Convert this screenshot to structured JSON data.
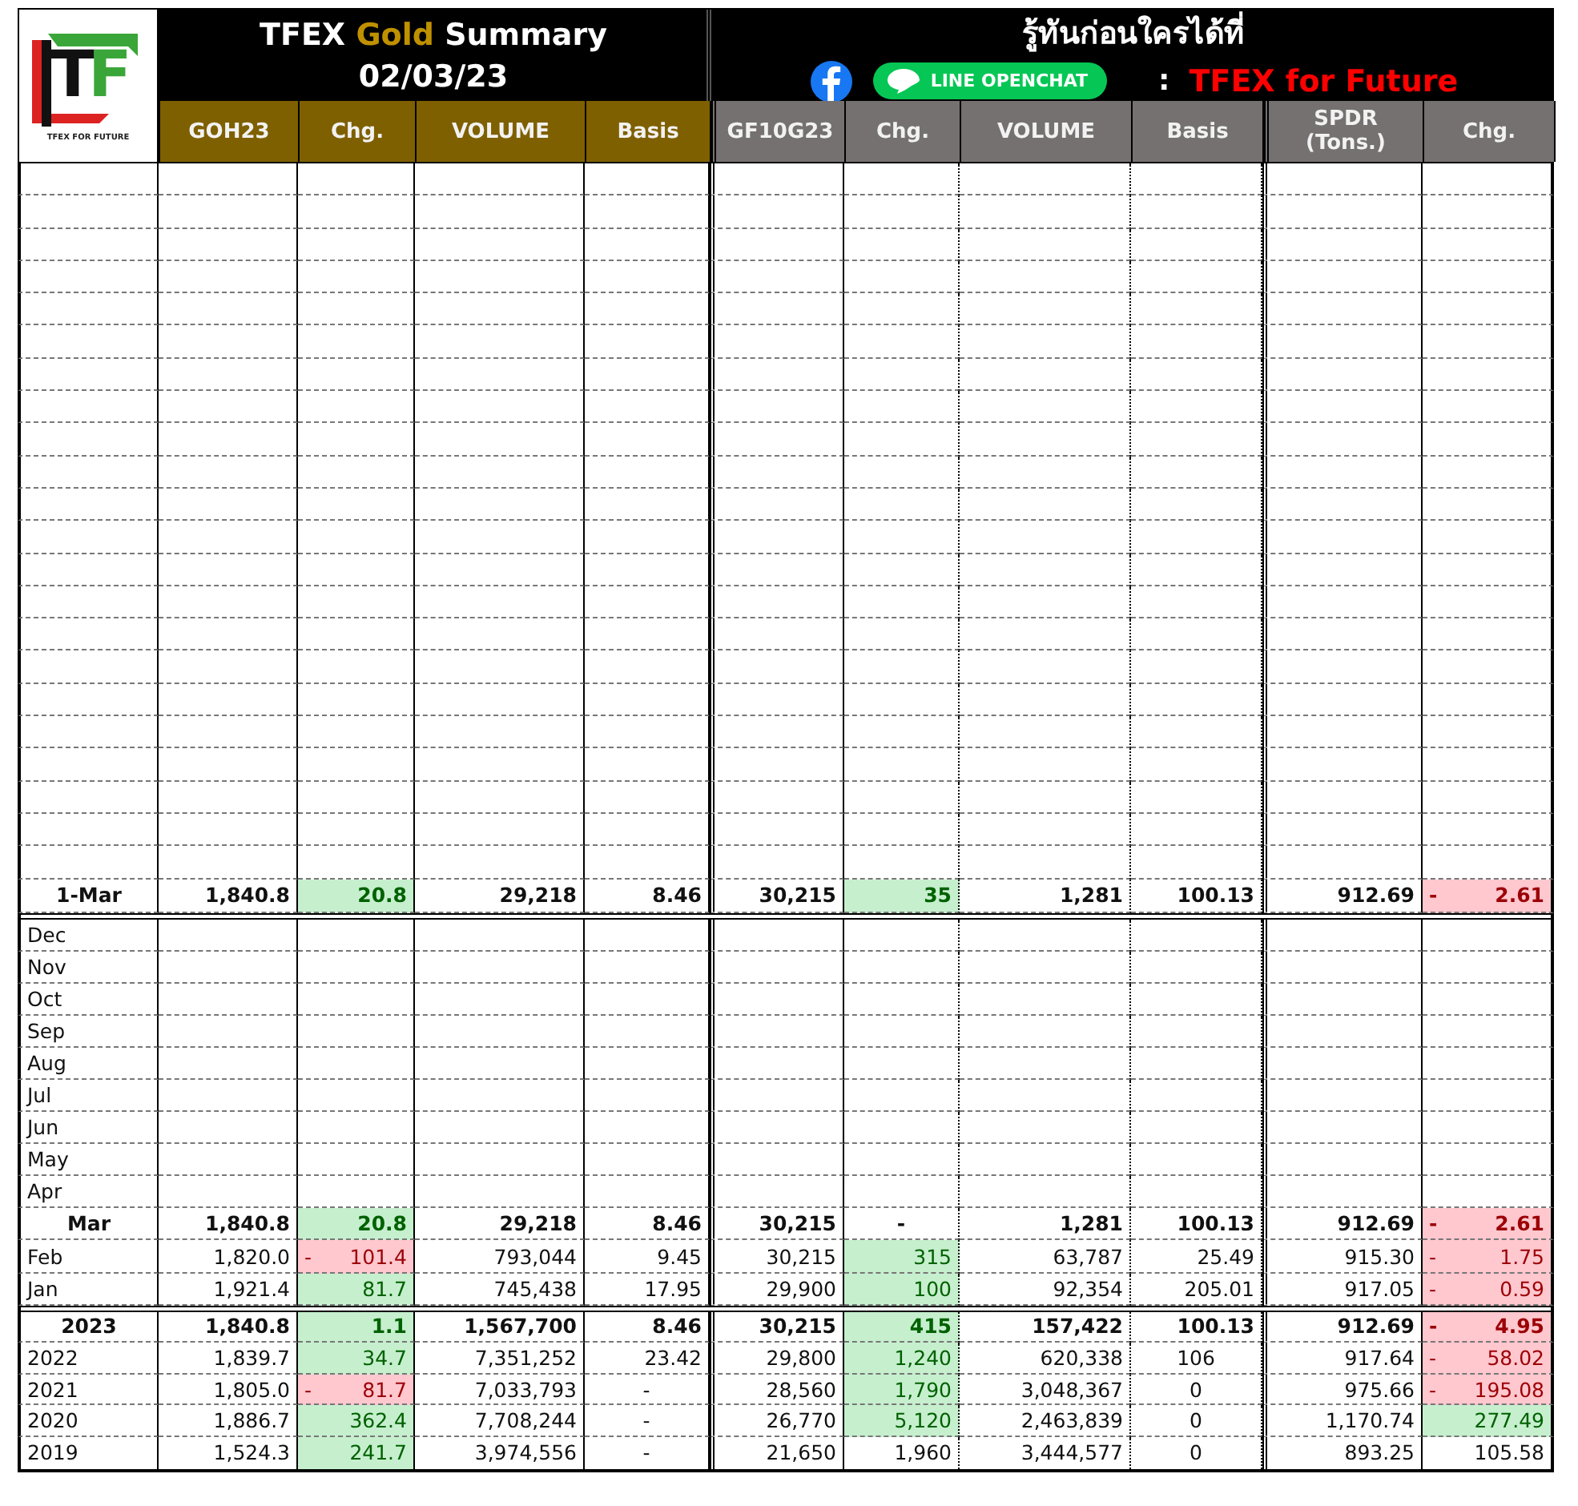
{
  "logo": {
    "letters": "TF",
    "tagline": "TFEX FOR FUTURE"
  },
  "title": {
    "lead": "TFEX",
    "highlight": "Gold",
    "tail": "Summary",
    "date": "02/03/23"
  },
  "promo": {
    "slogan": "รู้ทันก่อนใครได้ที่",
    "badge": "LINE OPENCHAT",
    "separator": ":",
    "channel": "TFEX for Future"
  },
  "columns": [
    {
      "label": "GOH23",
      "color": "#7f6000"
    },
    {
      "label": "Chg.",
      "color": "#7f6000"
    },
    {
      "label": "VOLUME",
      "color": "#7f6000"
    },
    {
      "label": "Basis",
      "color": "#7f6000"
    },
    {
      "label": "GF10G23",
      "color": "#767171"
    },
    {
      "label": "Chg.",
      "color": "#767171"
    },
    {
      "label": "VOLUME",
      "color": "#767171"
    },
    {
      "label": "Basis",
      "color": "#767171"
    },
    {
      "label": "SPDR (Tons.)",
      "color": "#767171"
    },
    {
      "label": "Chg.",
      "color": "#767171"
    }
  ],
  "daily": [
    {
      "label": "1-Mar",
      "kind": "total",
      "cells": [
        "1,840.8",
        {
          "value": "20.8",
          "color": "#c6efce"
        },
        "29,218",
        "8.46",
        "30,215",
        {
          "value": "35",
          "color": "#c6efce"
        },
        "1,281",
        "100.13",
        "912.69",
        {
          "sign": "-",
          "value": "2.61",
          "color": "#ffc7ce"
        }
      ]
    }
  ],
  "months": [
    {
      "label": "Dec",
      "kind": "plain"
    },
    {
      "label": "Nov",
      "kind": "plain"
    },
    {
      "label": "Oct",
      "kind": "plain"
    },
    {
      "label": "Sep",
      "kind": "plain"
    },
    {
      "label": "Aug",
      "kind": "plain"
    },
    {
      "label": "Jul",
      "kind": "plain"
    },
    {
      "label": "Jun",
      "kind": "plain"
    },
    {
      "label": "May",
      "kind": "plain"
    },
    {
      "label": "Apr",
      "kind": "plain"
    },
    {
      "label": "Mar",
      "kind": "total",
      "cells": [
        "1,840.8",
        {
          "value": "20.8",
          "color": "#c6efce"
        },
        "29,218",
        "8.46",
        "30,215",
        {
          "value": "-",
          "centered": true
        },
        "1,281",
        "100.13",
        "912.69",
        {
          "sign": "-",
          "value": "2.61",
          "color": "#ffc7ce"
        }
      ]
    },
    {
      "label": "Feb",
      "kind": "plain",
      "cells": [
        "1,820.0",
        {
          "sign": "-",
          "value": "101.4",
          "color": "#ffc7ce"
        },
        "793,044",
        "9.45",
        "30,215",
        {
          "value": "315",
          "color": "#c6efce"
        },
        "63,787",
        "25.49",
        "915.30",
        {
          "sign": "-",
          "value": "1.75",
          "color": "#ffc7ce"
        }
      ]
    },
    {
      "label": "Jan",
      "kind": "plain",
      "cells": [
        "1,921.4",
        {
          "value": "81.7",
          "color": "#c6efce"
        },
        "745,438",
        "17.95",
        "29,900",
        {
          "value": "100",
          "color": "#c6efce"
        },
        "92,354",
        "205.01",
        "917.05",
        {
          "sign": "-",
          "value": "0.59",
          "color": "#ffc7ce"
        }
      ]
    }
  ],
  "years": [
    {
      "label": "2023",
      "kind": "total",
      "cells": [
        "1,840.8",
        {
          "value": "1.1",
          "color": "#c6efce"
        },
        "1,567,700",
        "8.46",
        "30,215",
        {
          "value": "415",
          "color": "#c6efce"
        },
        "157,422",
        "100.13",
        "912.69",
        {
          "sign": "-",
          "value": "4.95",
          "color": "#ffc7ce"
        }
      ]
    },
    {
      "label": "2022",
      "kind": "plain",
      "cells": [
        "1,839.7",
        {
          "value": "34.7",
          "color": "#c6efce"
        },
        "7,351,252",
        "23.42",
        "29,800",
        {
          "value": "1,240",
          "color": "#c6efce"
        },
        "620,338",
        {
          "value": "106",
          "centered": true
        },
        "917.64",
        {
          "sign": "-",
          "value": "58.02",
          "color": "#ffc7ce"
        }
      ]
    },
    {
      "label": "2021",
      "kind": "plain",
      "cells": [
        "1,805.0",
        {
          "sign": "-",
          "value": "81.7",
          "color": "#ffc7ce"
        },
        "7,033,793",
        {
          "value": "-",
          "centered": true
        },
        "28,560",
        {
          "value": "1,790",
          "color": "#c6efce"
        },
        "3,048,367",
        {
          "value": "0",
          "centered": true
        },
        "975.66",
        {
          "sign": "-",
          "value": "195.08",
          "color": "#ffc7ce"
        }
      ]
    },
    {
      "label": "2020",
      "kind": "plain",
      "cells": [
        "1,886.7",
        {
          "value": "362.4",
          "color": "#c6efce"
        },
        "7,708,244",
        {
          "value": "-",
          "centered": true
        },
        "26,770",
        {
          "value": "5,120",
          "color": "#c6efce"
        },
        "2,463,839",
        {
          "value": "0",
          "centered": true
        },
        "1,170.74",
        {
          "value": "277.49",
          "color": "#c6efce"
        }
      ]
    },
    {
      "label": "2019",
      "kind": "plain",
      "cells": [
        "1,524.3",
        {
          "value": "241.7",
          "color": "#c6efce"
        },
        "3,974,556",
        {
          "value": "-",
          "centered": true
        },
        "21,650",
        "1,960",
        "3,444,577",
        {
          "value": "0",
          "centered": true
        },
        "893.25",
        "105.58"
      ]
    }
  ]
}
